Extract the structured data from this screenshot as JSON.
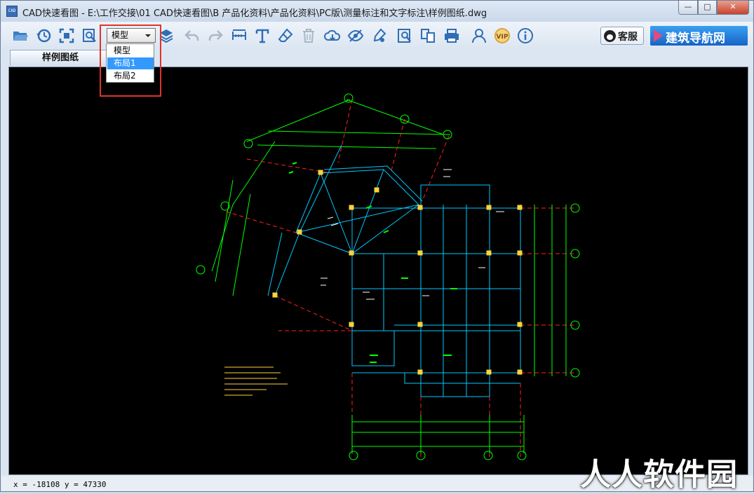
{
  "window": {
    "icon_text": "CAD",
    "title": "CAD快速看图 - E:\\工作交接\\01 CAD快速看图\\B 产品化资料\\产品化资料\\PC版\\测量标注和文字标注\\样例图纸.dwg",
    "minimize_label": "—",
    "maximize_label": "□",
    "close_label": "✕"
  },
  "toolbar": {
    "view_select": {
      "value": "模型",
      "options": [
        "模型",
        "布局1",
        "布局2"
      ],
      "highlighted": "布局1"
    },
    "kefu_label": "客服",
    "banner_label": "建筑导航网",
    "icons": [
      "open-folder-icon",
      "history-icon",
      "fit-view-icon",
      "zoom-window-icon",
      "layers-icon",
      "undo-icon",
      "redo-icon",
      "measure-icon",
      "text-icon",
      "eraser-icon",
      "trash-icon",
      "cloud-download-icon",
      "hide-eye-icon",
      "pen-settings-icon",
      "find-text-icon",
      "convert-icon",
      "print-icon",
      "user-icon",
      "vip-icon",
      "info-icon"
    ]
  },
  "tabs": {
    "document_tab": "样例图纸"
  },
  "status": {
    "coordinates": "x = -18108  y = 47330"
  },
  "watermark": "人人软件园",
  "colors": {
    "canvas_bg": "#000000",
    "accent_red": "#e0332a",
    "drawing_green": "#00ff00",
    "drawing_cyan": "#00c8ff",
    "drawing_red": "#ff2020",
    "icon_blue": "#2f6eb5"
  }
}
